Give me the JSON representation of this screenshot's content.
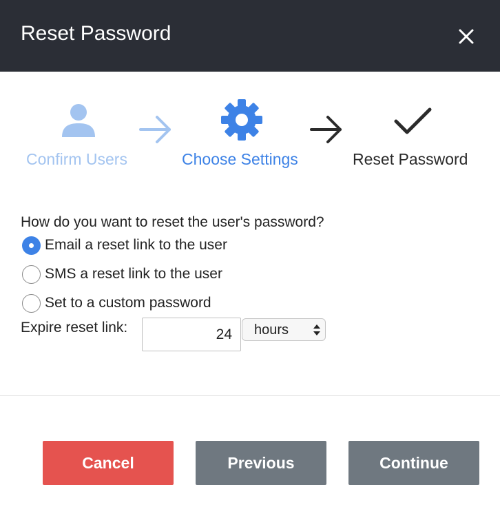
{
  "dialog": {
    "title": "Reset Password"
  },
  "steps": [
    {
      "label": "Confirm Users",
      "icon": "user-icon",
      "state": "completed",
      "color": "#a3c4f0"
    },
    {
      "label": "Choose Settings",
      "icon": "gear-icon",
      "state": "active",
      "color": "#3d82e6"
    },
    {
      "label": "Reset Password",
      "icon": "check-icon",
      "state": "upcoming",
      "color": "#2b2b2b"
    }
  ],
  "form": {
    "question": "How do you want to reset the user's password?",
    "options": [
      {
        "label": "Email a reset link to the user",
        "checked": true
      },
      {
        "label": "SMS a reset link to the user",
        "checked": false
      },
      {
        "label": "Set to a custom password",
        "checked": false
      }
    ],
    "expire_label": "Expire reset link:",
    "expire_value": "24",
    "expire_unit": "hours"
  },
  "buttons": {
    "cancel": "Cancel",
    "previous": "Previous",
    "continue": "Continue"
  },
  "colors": {
    "header_bg": "#2b2e36",
    "accent": "#3d82e6",
    "accent_light": "#a3c4f0",
    "danger": "#e5534f",
    "secondary": "#6f7880"
  }
}
